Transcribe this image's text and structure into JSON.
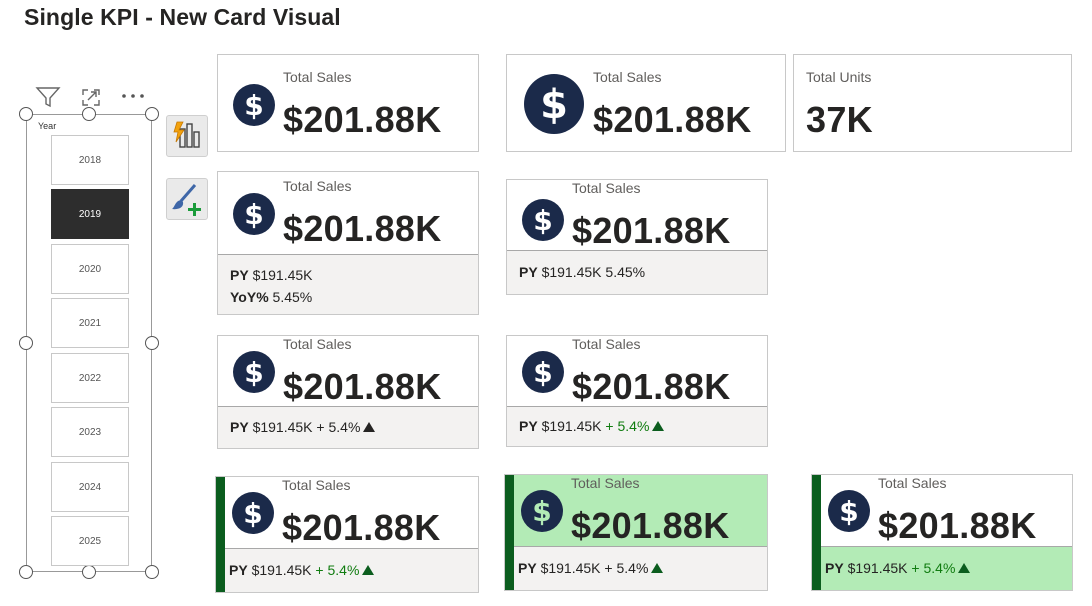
{
  "title": "Single KPI - New Card Visual",
  "colors": {
    "navy": "#1b2a4a",
    "accent_green": "#0b5d1e",
    "light_green": "#b3ebb6",
    "footer_gray": "#f3f2f1"
  },
  "slicer": {
    "header": "Year",
    "years": [
      "2018",
      "2019",
      "2020",
      "2021",
      "2022",
      "2023",
      "2024",
      "2025"
    ],
    "selected": "2019",
    "header_icons": [
      "filter-icon",
      "focus-mode-icon",
      "more-options-icon"
    ]
  },
  "side_tools": [
    "format-visual-icon",
    "analytics-brush-icon"
  ],
  "cards": {
    "c1": {
      "label": "Total Sales",
      "value": "$201.88K",
      "icon": "dollar-icon"
    },
    "c2": {
      "label": "Total Sales",
      "value": "$201.88K",
      "icon": "dollar-icon"
    },
    "c3": {
      "label": "Total Units",
      "value": "37K"
    },
    "c4": {
      "label": "Total Sales",
      "value": "$201.88K",
      "py_label": "PY",
      "py_value": "$191.45K",
      "yoy_label": "YoY%",
      "yoy_value": "5.45%"
    },
    "c5": {
      "label": "Total Sales",
      "value": "$201.88K",
      "py_label": "PY",
      "py_value": "$191.45K",
      "yoy_value": "5.45%"
    },
    "c6": {
      "label": "Total Sales",
      "value": "$201.88K",
      "py_label": "PY",
      "py_value": "$191.45K",
      "change": "+ 5.4%"
    },
    "c7": {
      "label": "Total Sales",
      "value": "$201.88K",
      "py_label": "PY",
      "py_value": "$191.45K",
      "change": "+ 5.4%"
    },
    "c8": {
      "label": "Total Sales",
      "value": "$201.88K",
      "py_label": "PY",
      "py_value": "$191.45K",
      "change": "+ 5.4%"
    },
    "c9": {
      "label": "Total Sales",
      "value": "$201.88K",
      "py_label": "PY",
      "py_value": "$191.45K",
      "change": "+ 5.4%"
    },
    "c10": {
      "label": "Total Sales",
      "value": "$201.88K",
      "py_label": "PY",
      "py_value": "$191.45K",
      "change": "+ 5.4%"
    }
  }
}
